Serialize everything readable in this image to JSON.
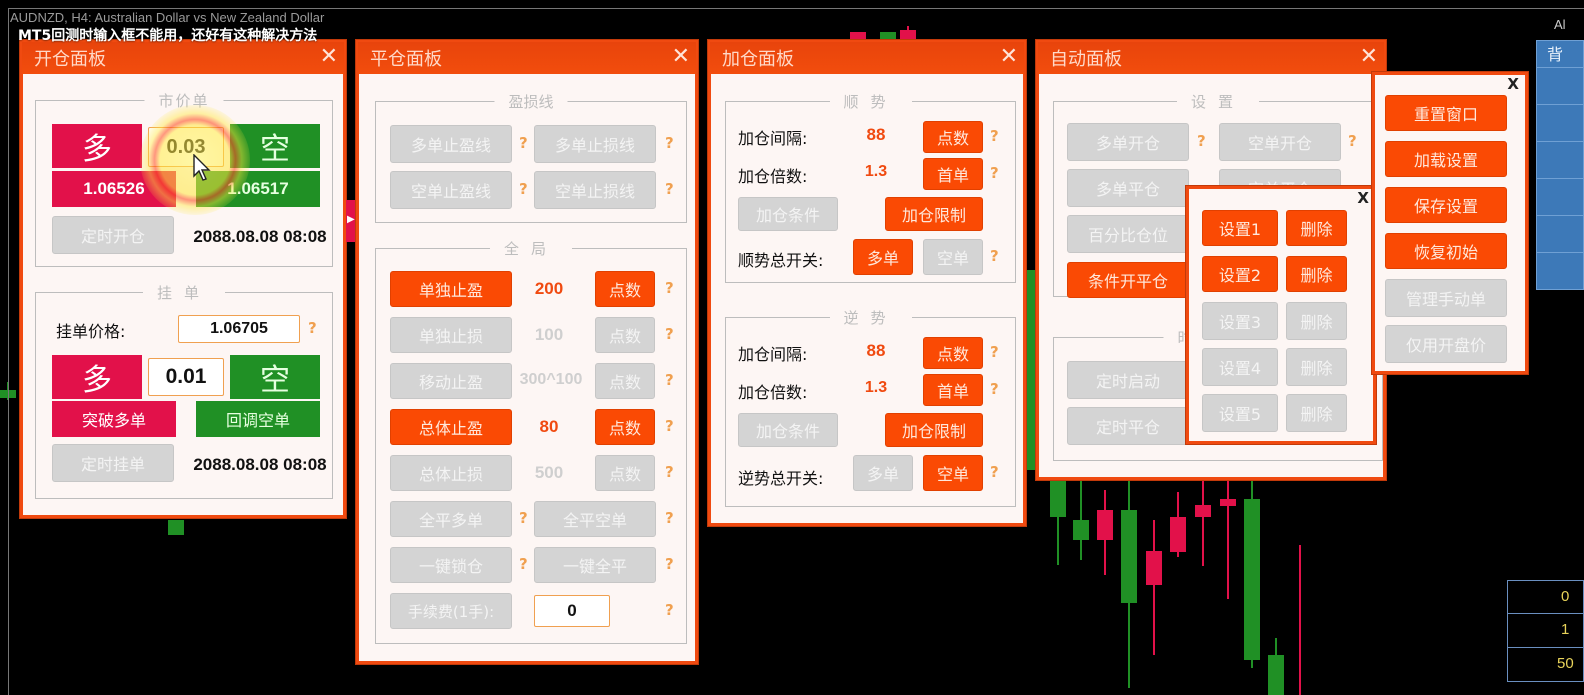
{
  "chart": {
    "title": "AUDNZD, H4:  Australian Dollar vs New Zealand Dollar",
    "overlay_caption": "MT5回测时输入框不能用，还好有这种解决方法",
    "corner_label": "Al",
    "colors": {
      "bull": "#209025",
      "bear": "#e2114a",
      "accent": "#f04a10"
    }
  },
  "open_panel": {
    "title": "开仓面板",
    "close": "✕",
    "market": {
      "title": "市价单",
      "buy_label": "多",
      "sell_label": "空",
      "lot": "0.03",
      "buy_price": "1.06526",
      "sell_price": "1.06517",
      "timer_button": "定时开仓",
      "timer_value": "2088.08.08 08:08"
    },
    "pending": {
      "title": "挂单",
      "price_label": "挂单价格:",
      "price_value": "1.06705",
      "help": "?",
      "buy_label": "多",
      "sell_label": "空",
      "lot": "0.01",
      "breakout_buy": "突破多单",
      "pullback_sell": "回调空单",
      "timer_button": "定时挂单",
      "timer_value": "2088.08.08 08:08"
    }
  },
  "close_panel": {
    "title": "平仓面板",
    "close": "✕",
    "sl_tp_lines": {
      "title": "盈损线",
      "buttons": [
        "多单止盈线",
        "多单止损线",
        "空单止盈线",
        "空单止损线"
      ]
    },
    "global": {
      "title": "全局",
      "rows": [
        {
          "label": "单独止盈",
          "value": "200",
          "unit": "点数",
          "active": true
        },
        {
          "label": "单独止损",
          "value": "100",
          "unit": "点数",
          "active": false
        },
        {
          "label": "移动止盈",
          "value": "300^100",
          "unit": "点数",
          "active": false
        },
        {
          "label": "总体止盈",
          "value": "80",
          "unit": "点数",
          "active": true
        },
        {
          "label": "总体止损",
          "value": "500",
          "unit": "点数",
          "active": false
        }
      ],
      "close_all_buy": "全平多单",
      "close_all_sell": "全平空单",
      "lock": "一键锁仓",
      "close_all": "一键全平",
      "fee_label": "手续费(1手):",
      "fee_value": "0"
    }
  },
  "add_panel": {
    "title": "加仓面板",
    "close": "✕",
    "trend": {
      "title": "顺势",
      "interval_label": "加仓间隔:",
      "interval_value": "88",
      "interval_unit": "点数",
      "multiplier_label": "加仓倍数:",
      "multiplier_value": "1.3",
      "multiplier_unit": "首单",
      "condition": "加仓条件",
      "limit": "加仓限制",
      "switch_label": "顺势总开关:",
      "buy": "多单",
      "sell": "空单"
    },
    "counter": {
      "title": "逆势",
      "interval_label": "加仓间隔:",
      "interval_value": "88",
      "interval_unit": "点数",
      "multiplier_label": "加仓倍数:",
      "multiplier_value": "1.3",
      "multiplier_unit": "首单",
      "condition": "加仓条件",
      "limit": "加仓限制",
      "switch_label": "逆势总开关:",
      "buy": "多单",
      "sell": "空单"
    }
  },
  "auto_panel": {
    "title": "自动面板",
    "close": "✕",
    "settings": {
      "title": "设置",
      "buy_open": "多单开仓",
      "sell_open": "空单开仓",
      "buy_close": "多单平仓",
      "sell_close": "空单平仓",
      "percent_position": "百分比仓位",
      "conditional": "条件开平仓"
    },
    "timer": {
      "title": "时",
      "timer_start": "定时启动",
      "timer_close": "定时平仓"
    }
  },
  "preset_popup": {
    "close": "X",
    "rows": [
      {
        "label": "设置1",
        "delete": "删除",
        "active": true
      },
      {
        "label": "设置2",
        "delete": "删除",
        "active": true
      },
      {
        "label": "设置3",
        "delete": "删除",
        "active": false
      },
      {
        "label": "设置4",
        "delete": "删除",
        "active": false
      },
      {
        "label": "设置5",
        "delete": "删除",
        "active": false
      }
    ]
  },
  "menu_popup": {
    "close": "X",
    "items": [
      {
        "label": "重置窗口",
        "active": true
      },
      {
        "label": "加载设置",
        "active": true
      },
      {
        "label": "保存设置",
        "active": true
      },
      {
        "label": "恢复初始",
        "active": true
      },
      {
        "label": "管理手动单",
        "active": false
      },
      {
        "label": "仅用开盘价",
        "active": false
      }
    ]
  },
  "side_table": {
    "header": "背"
  },
  "num_table": {
    "values": [
      "0",
      "1",
      "50"
    ]
  },
  "help": "?"
}
